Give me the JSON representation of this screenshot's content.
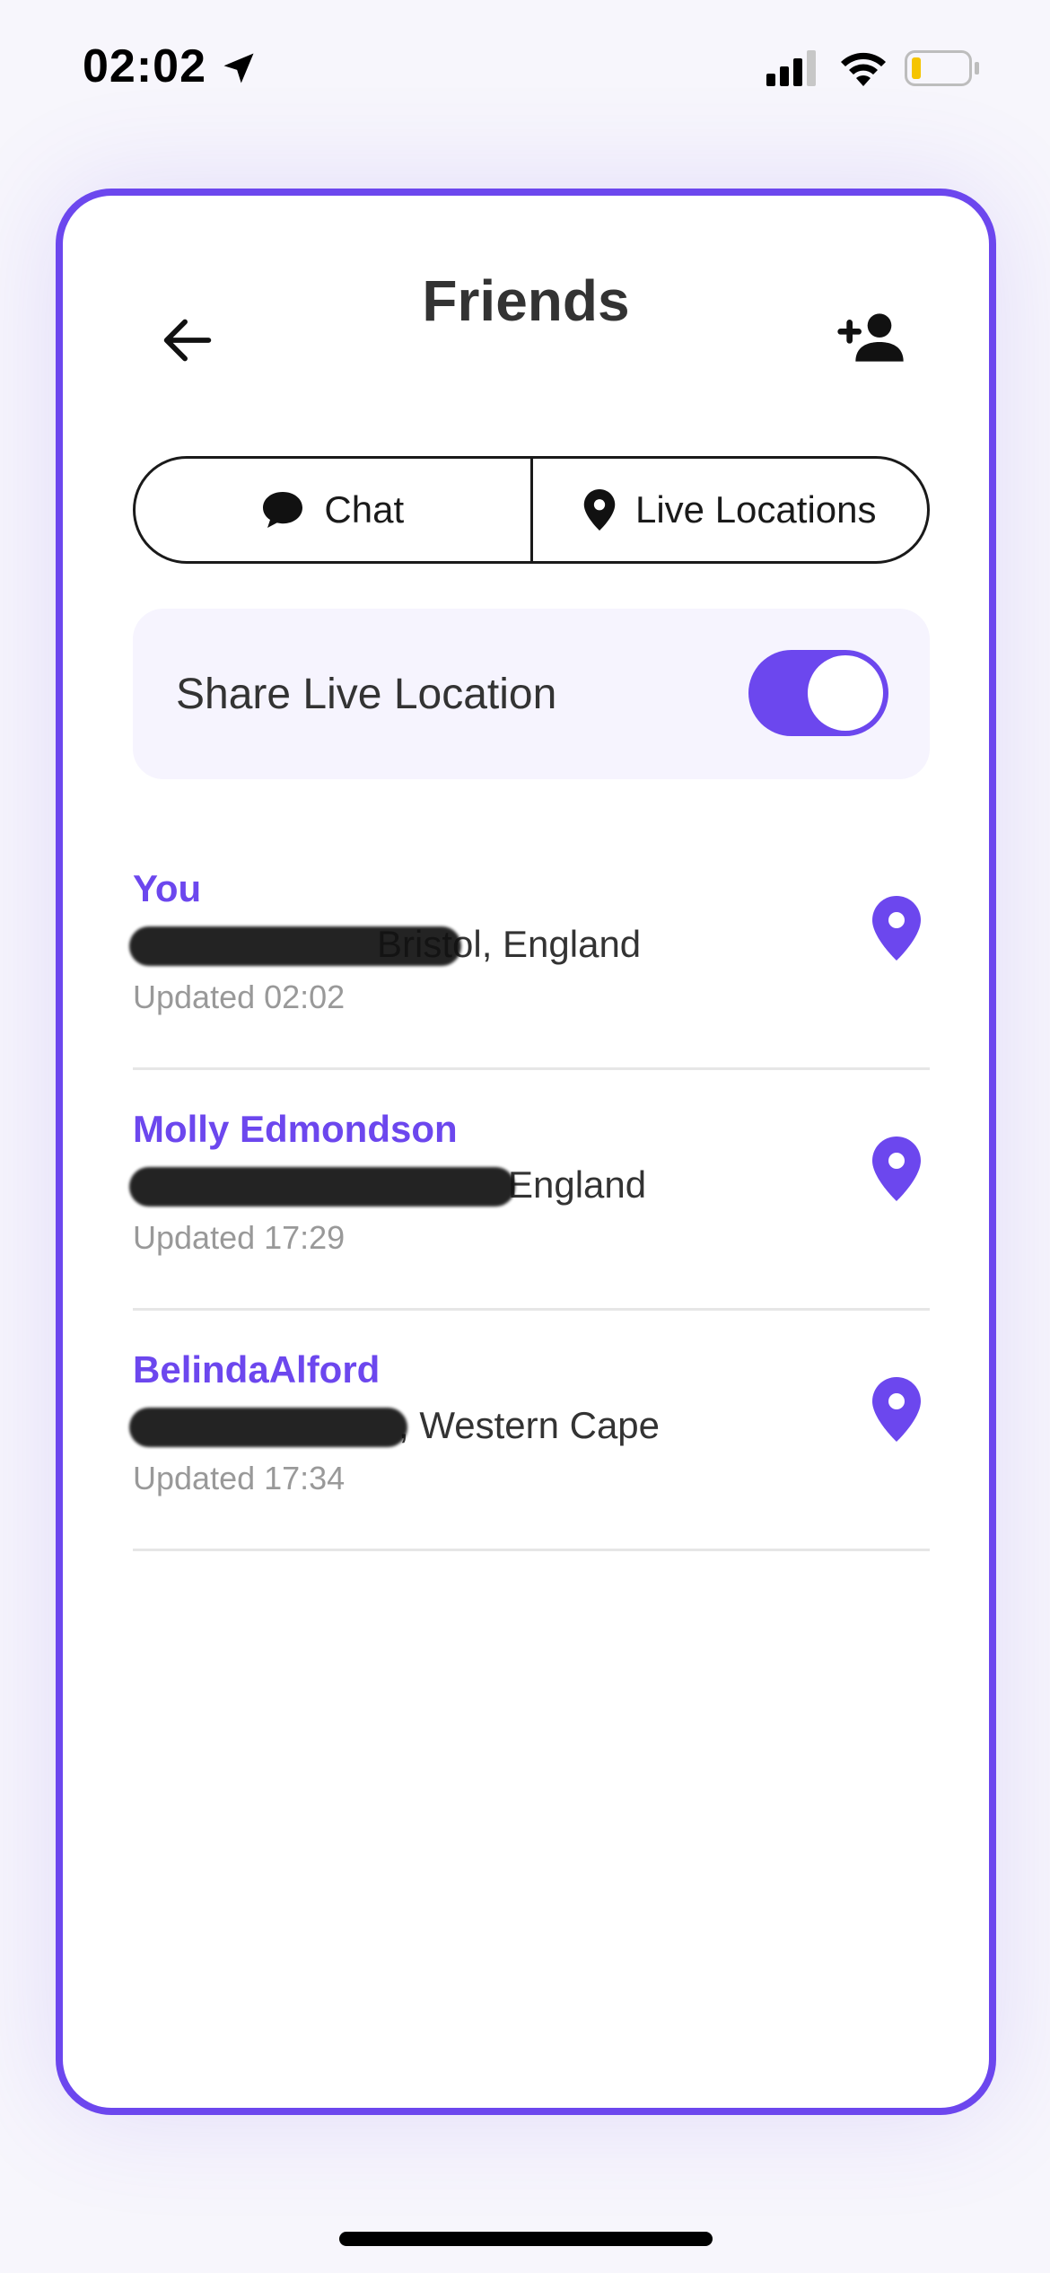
{
  "status_bar": {
    "time": "02:02",
    "battery_color": "#f5c400"
  },
  "header": {
    "title": "Friends"
  },
  "tabs": [
    {
      "label": "Chat",
      "icon": "chat-bubble-icon"
    },
    {
      "label": "Live Locations",
      "icon": "map-pin-icon"
    }
  ],
  "share_location": {
    "label": "Share Live Location",
    "enabled": true
  },
  "friends": [
    {
      "name": "You",
      "address": "2 ███████ Bristol, England",
      "visible_address": "Bristol, England",
      "updated": "Updated 02:02"
    },
    {
      "name": "Molly Edmondson",
      "address": "2 ███████████ England",
      "visible_address": "England",
      "updated": "Updated 17:29"
    },
    {
      "name": "BelindaAlford",
      "address": "U ██████ Road, Western Cape",
      "visible_address": ", Western Cape",
      "updated": "Updated 17:34"
    }
  ],
  "colors": {
    "accent": "#6c47ee",
    "text": "#333333",
    "muted": "#999999"
  }
}
